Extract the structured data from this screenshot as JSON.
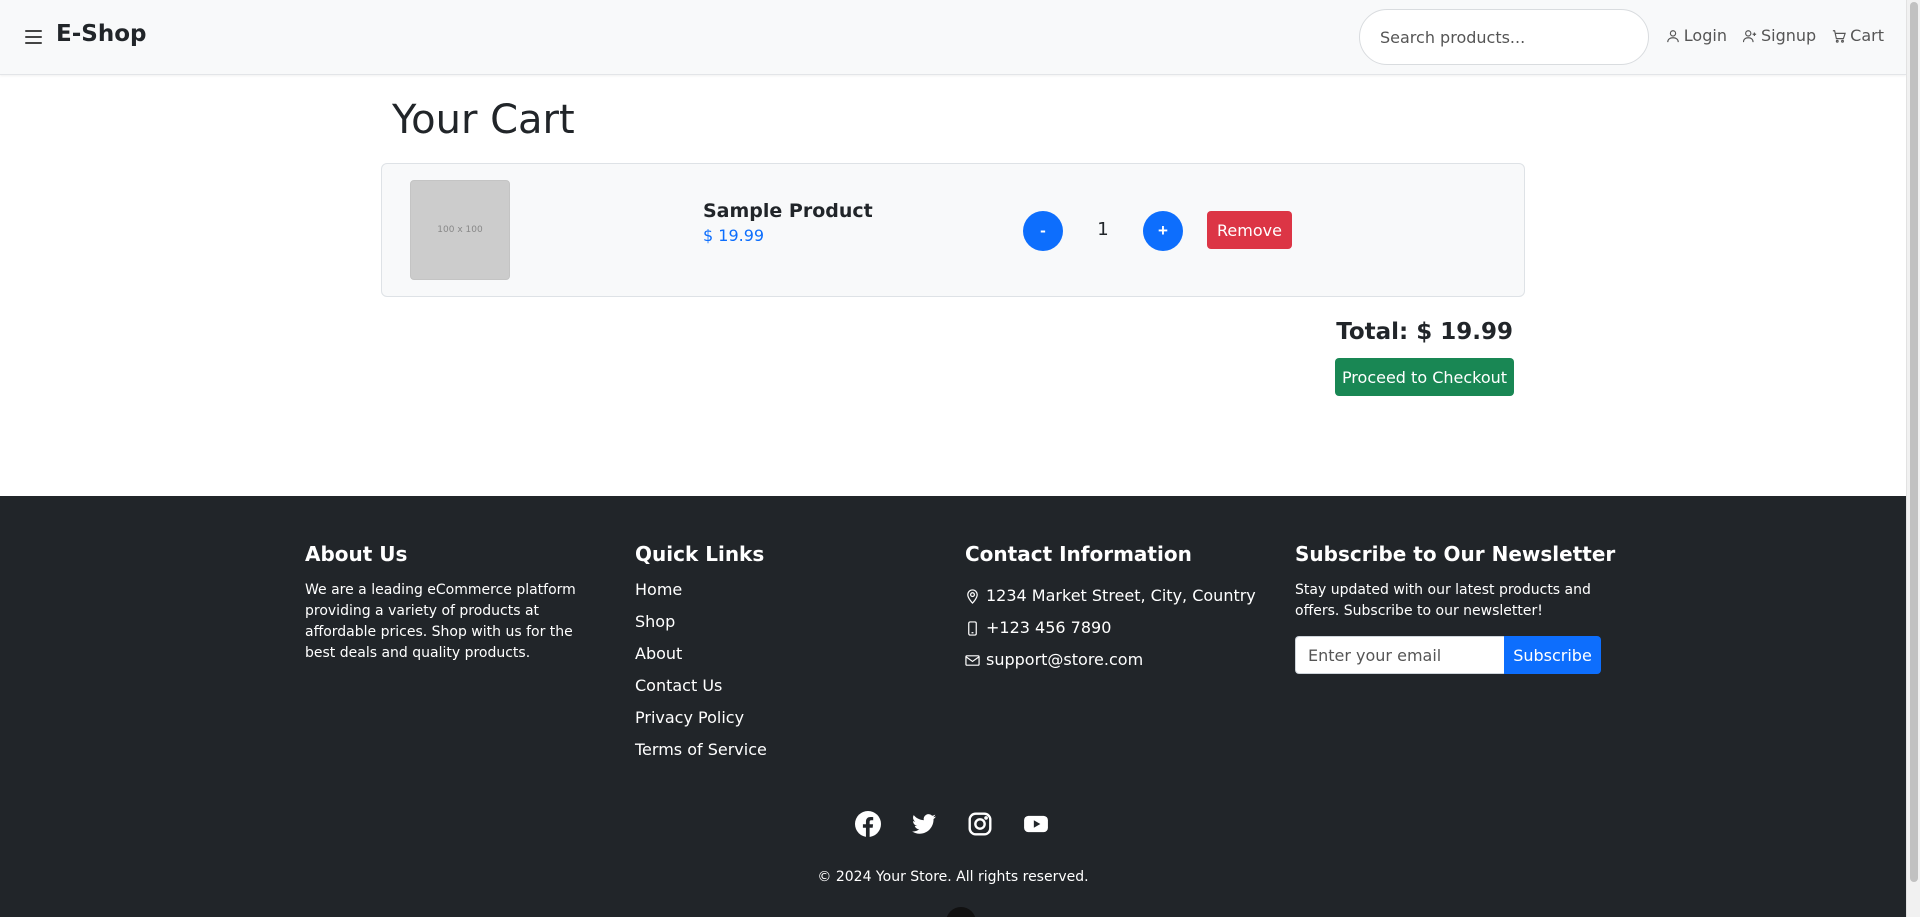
{
  "navbar": {
    "brand": "E-Shop",
    "search_placeholder": "Search products...",
    "links": {
      "login": "Login",
      "signup": "Signup",
      "cart": "Cart"
    }
  },
  "cart": {
    "title": "Your Cart",
    "items": [
      {
        "image_text": "100 x 100",
        "name": "Sample Product",
        "price": "$ 19.99",
        "quantity": "1",
        "minus_label": "-",
        "plus_label": "+",
        "remove_label": "Remove"
      }
    ],
    "total": "Total: $ 19.99",
    "checkout_label": "Proceed to Checkout"
  },
  "footer": {
    "about": {
      "heading": "About Us",
      "text": "We are a leading eCommerce platform providing a variety of products at affordable prices. Shop with us for the best deals and quality products."
    },
    "quick_links": {
      "heading": "Quick Links",
      "items": [
        "Home",
        "Shop",
        "About",
        "Contact Us",
        "Privacy Policy",
        "Terms of Service"
      ]
    },
    "contact": {
      "heading": "Contact Information",
      "address": "1234 Market Street, City, Country",
      "phone": "+123 456 7890",
      "email": "support@store.com"
    },
    "newsletter": {
      "heading": "Subscribe to Our Newsletter",
      "text": "Stay updated with our latest products and offers. Subscribe to our newsletter!",
      "placeholder": "Enter your email",
      "button_label": "Subscribe"
    },
    "socials": [
      "facebook-icon",
      "twitter-icon",
      "instagram-icon",
      "youtube-icon"
    ],
    "copyright": "© 2024 Your Store. All rights reserved."
  },
  "colors": {
    "primary": "#0d6efd",
    "danger": "#dc3545",
    "success": "#198754",
    "footer_bg": "#212529",
    "navbar_bg": "#f8f9fa"
  }
}
